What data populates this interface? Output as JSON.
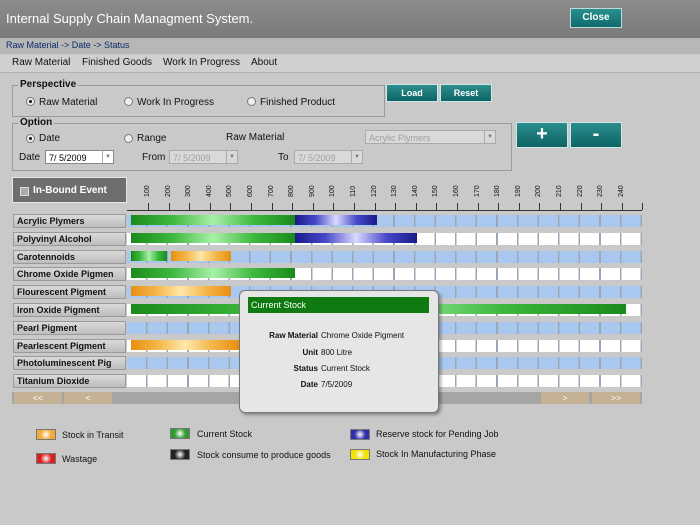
{
  "app": {
    "title": "Internal Supply Chain Managment System.",
    "close_label": "Close"
  },
  "breadcrumb": "Raw Material -> Date -> Status",
  "menu": [
    "Raw Material",
    "Finished Goods",
    "Work In Progress",
    "About"
  ],
  "perspective": {
    "title": "Perspective",
    "options": [
      "Raw Material",
      "Work In Progress",
      "Finished Product"
    ],
    "selected": "Raw Material"
  },
  "buttons": {
    "load": "Load",
    "reset": "Reset",
    "zoom_in": "+",
    "zoom_out": "-"
  },
  "option": {
    "title": "Option",
    "date_radio": "Date",
    "range_radio": "Range",
    "selected": "Date",
    "raw_material_label": "Raw Material",
    "raw_material_value": "Acrylic Plymers",
    "date_label": "Date",
    "date_value": "7/ 5/2009",
    "from_label": "From",
    "from_value": "7/ 5/2009",
    "to_label": "To",
    "to_value": "7/ 5/2009"
  },
  "chart": {
    "inbound_label": "In-Bound Event",
    "ticks": [
      "100",
      "200",
      "300",
      "400",
      "500",
      "600",
      "700",
      "800",
      "900",
      "100",
      "110",
      "120",
      "130",
      "140",
      "150",
      "160",
      "170",
      "180",
      "190",
      "200",
      "210",
      "220",
      "230",
      "240"
    ],
    "rows": [
      "Acrylic Plymers",
      "Polyvinyl Alcohol",
      "Carotennoids",
      "Chrome Oxide Pigmen",
      "Flourescent Pigment",
      "Iron Oxide Pigment",
      "Pearl Pigment",
      "Pearlescent Pigment",
      "Photoluminescent Pig",
      "Titanium Dioxide"
    ],
    "scroll": {
      "first": "<<",
      "prev": "<",
      "next": ">",
      "last": ">>"
    }
  },
  "tooltip": {
    "title": "Current Stock",
    "fields": [
      {
        "key": "Raw Material",
        "value": "Chrome Oxide Pigment"
      },
      {
        "key": "Unit",
        "value": "800 Litre"
      },
      {
        "key": "Status",
        "value": "Current Stock"
      },
      {
        "key": "Date",
        "value": "7/5/2009"
      }
    ]
  },
  "legend": [
    {
      "label": "Stock in Transit",
      "color": "#f2a93b"
    },
    {
      "label": "Current Stock",
      "color": "#2e9c2e"
    },
    {
      "label": "Reserve stock for Pending Job",
      "color": "#3030a8"
    },
    {
      "label": "Wastage",
      "color": "#d82020"
    },
    {
      "label": "Stock consume to produce goods",
      "color": "#222222"
    },
    {
      "label": "Stock In Manufacturing Phase",
      "color": "#f2e200"
    }
  ],
  "colors": {
    "accent": "#0f6a6a",
    "grid_blue": "#a9c8f0",
    "grid_white": "#ffffff"
  }
}
